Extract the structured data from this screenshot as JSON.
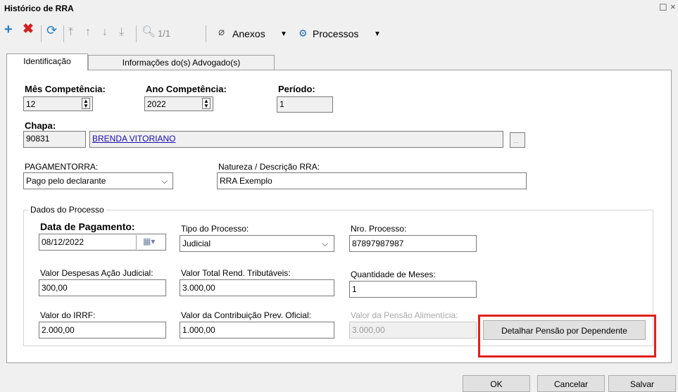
{
  "window": {
    "title": "Histórico de RRA"
  },
  "toolbar": {
    "page": "1/1",
    "menus": {
      "anexos": "Anexos",
      "processos": "Processos"
    }
  },
  "tabs": [
    "Identificação",
    "Informações do(s) Advogado(s)"
  ],
  "ident": {
    "mes_label": "Mês Competência:",
    "mes": "12",
    "ano_label": "Ano Competência:",
    "ano": "2022",
    "periodo_label": "Período:",
    "periodo": "1",
    "chapa_label": "Chapa:",
    "chapa": "90831",
    "nome": "BRENDA VITORIANO",
    "pagamento_label": "PAGAMENTORRA:",
    "pagamento": "Pago pelo declarante",
    "natureza_label": "Natureza / Descrição RRA:",
    "natureza": "RRA Exemplo"
  },
  "processo": {
    "legend": "Dados do Processo",
    "data_label": "Data de Pagamento:",
    "data": "08/12/2022",
    "tipo_label": "Tipo do Processo:",
    "tipo": "Judicial",
    "nro_label": "Nro. Processo:",
    "nro": "87897987987",
    "despesas_label": "Valor Despesas Ação Judicial:",
    "despesas": "300,00",
    "total_label": "Valor Total Rend. Tributáveis:",
    "total": "3.000,00",
    "meses_label": "Quantidade de Meses:",
    "meses": "1",
    "irrf_label": "Valor do IRRF:",
    "irrf": "2.000,00",
    "contrib_label": "Valor da Contribuição Prev. Oficial:",
    "contrib": "1.000,00",
    "pensao_label": "Valor da Pensão Alimentícia:",
    "pensao": "3.000,00",
    "detalhar": "Detalhar Pensão por Dependente"
  },
  "footer": {
    "ok": "OK",
    "cancelar": "Cancelar",
    "salvar": "Salvar"
  },
  "colors": {
    "add": "#2a7fc1",
    "delete": "#d21f1f",
    "highlight": "#e0201b",
    "link": "#1a0dab"
  }
}
